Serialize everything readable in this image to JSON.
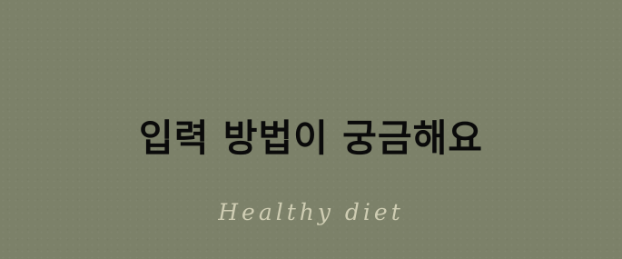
{
  "banner": {
    "headline": "입력 방법이 궁금해요",
    "tagline": "Healthy diet"
  },
  "colors": {
    "background": "#7c8169",
    "headline": "#0a0a0a",
    "tagline": "#cfcdb3"
  }
}
